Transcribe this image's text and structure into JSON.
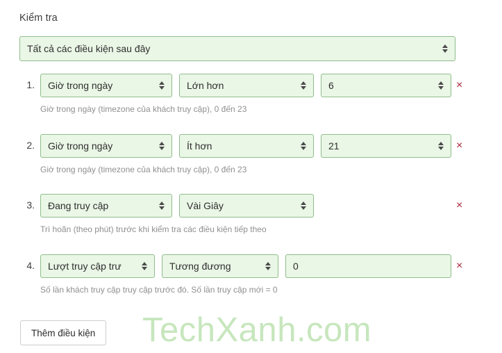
{
  "section": {
    "title": "Kiểm tra"
  },
  "match_select": {
    "value": "Tất cả các điều kiện sau đây",
    "stepper_icon": "stepper-updown-icon"
  },
  "conditions": [
    {
      "num": "1.",
      "subject": "Giờ trong ngày",
      "operator": "Lớn hơn",
      "value": "6",
      "helper": "Giờ trong ngày (timezone của khách truy cập), 0 đến 23",
      "remove_icon": "×",
      "has_value_field": true,
      "value_is_stepper": true
    },
    {
      "num": "2.",
      "subject": "Giờ trong ngày",
      "operator": "Ít hơn",
      "value": "21",
      "helper": "Giờ trong ngày (timezone của khách truy cập), 0 đến 23",
      "remove_icon": "×",
      "has_value_field": true,
      "value_is_stepper": true
    },
    {
      "num": "3.",
      "subject": "Đang truy cập",
      "operator": "Vài Giây",
      "value": "",
      "helper": "Trì hoãn (theo phút) trước khi kiểm tra các điều kiện tiếp theo",
      "remove_icon": "×",
      "has_value_field": false,
      "value_is_stepper": false
    },
    {
      "num": "4.",
      "subject": "Lượt truy cập trư",
      "operator": "Tương đương",
      "value": "0",
      "helper": "Số lần khách truy cập truy cập trước đó. Số lần truy cập mới = 0",
      "remove_icon": "×",
      "has_value_field": true,
      "value_is_stepper": false
    }
  ],
  "footer": {
    "add_condition_label": "Thêm điều kiện"
  },
  "watermark": {
    "text": "TechXanh.com"
  },
  "colors": {
    "field_bg": "#eaf6e6",
    "field_border": "#8fbd8c",
    "remove_x": "#a8243a",
    "helper_text": "#8f8f8f",
    "watermark": "#c7e6bd",
    "page_bg": "#ffffff"
  }
}
